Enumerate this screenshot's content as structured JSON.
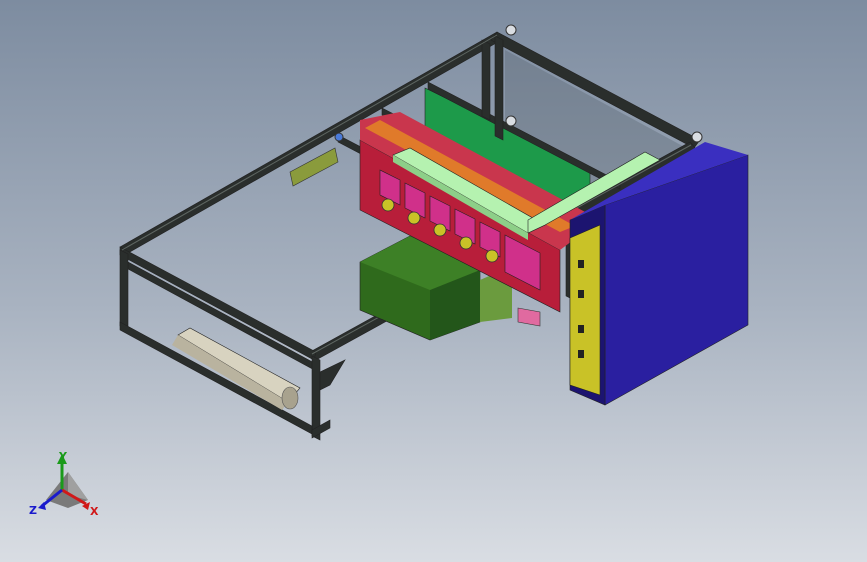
{
  "viewport": {
    "background_top": "#7d8ca0",
    "background_bottom": "#d9dde3"
  },
  "triad": {
    "x_label": "X",
    "y_label": "Y",
    "z_label": "Z",
    "x_color": "#d01818",
    "y_color": "#1a9a1a",
    "z_color": "#1a1acc"
  },
  "model": {
    "frame_color": "#2a2e2c",
    "cabinet_color": "#2a1fa0",
    "cabinet_side_color": "#1c1470",
    "panel_green_color": "#1d9a4a",
    "guide_rail_color": "#b5f2b0",
    "carriage_color": "#b81e3a",
    "fixture_pink_color": "#d0308a",
    "motor_box_color": "#2f6a1c",
    "plate_yellow_color": "#c9c227",
    "roller_color": "#d8d3c0"
  }
}
